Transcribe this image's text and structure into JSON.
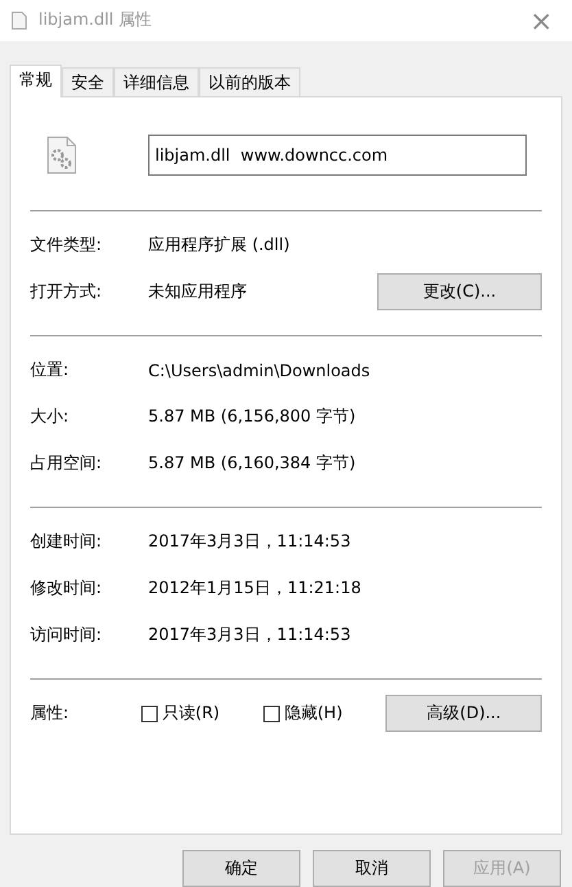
{
  "window": {
    "title": "libjam.dll 属性",
    "close": "×"
  },
  "tabs": [
    {
      "label": "常规",
      "selected": true
    },
    {
      "label": "安全",
      "selected": false
    },
    {
      "label": "详细信息",
      "selected": false
    },
    {
      "label": "以前的版本",
      "selected": false
    }
  ],
  "file_name": "libjam.dll  www.downcc.com",
  "sections": [
    [
      {
        "label": "文件类型:",
        "value": "应用程序扩展 (.dll)"
      },
      {
        "label": "打开方式:",
        "value": "未知应用程序",
        "button": "更改(C)..."
      }
    ],
    [
      {
        "label": "位置:",
        "value": "C:\\Users\\admin\\Downloads"
      },
      {
        "label": "大小:",
        "value": "5.87 MB (6,156,800 字节)"
      },
      {
        "label": "占用空间:",
        "value": "5.87 MB (6,160,384 字节)"
      }
    ],
    [
      {
        "label": "创建时间:",
        "value": "2017年3月3日，11:14:53"
      },
      {
        "label": "修改时间:",
        "value": "2012年1月15日，11:21:18"
      },
      {
        "label": "访问时间:",
        "value": "2017年3月3日，11:14:53"
      }
    ]
  ],
  "attributes": {
    "label": "属性:",
    "checkboxes": [
      {
        "label": "只读(R)",
        "checked": false
      },
      {
        "label": "隐藏(H)",
        "checked": false
      }
    ],
    "button": "高级(D)..."
  },
  "buttons": [
    {
      "label": "确定",
      "disabled": false
    },
    {
      "label": "取消",
      "disabled": false
    },
    {
      "label": "应用(A)",
      "disabled": true
    }
  ]
}
